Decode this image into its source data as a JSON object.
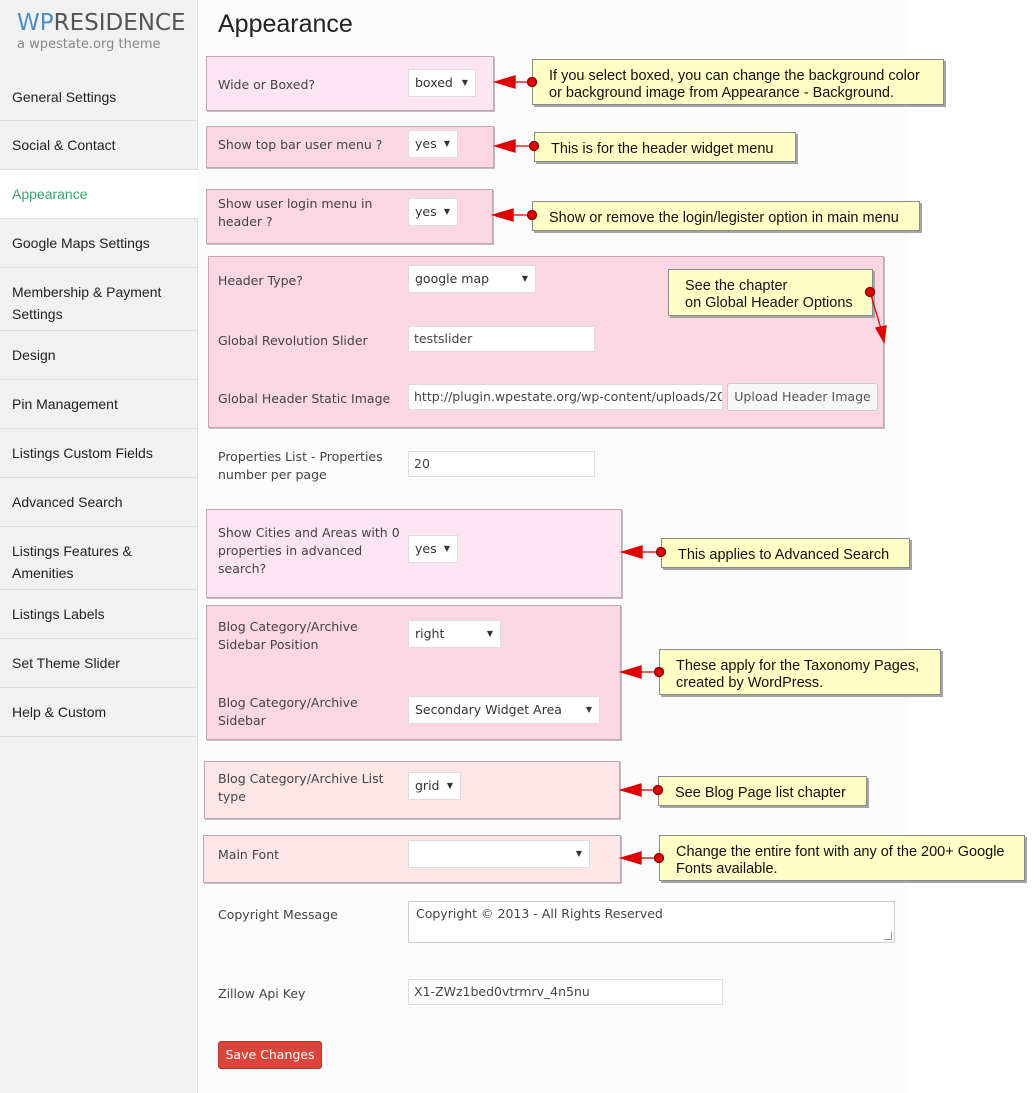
{
  "sidebar": {
    "logo_brand_wp": "WP",
    "logo_brand_rest": "RESIDENCE",
    "logo_tagline": "a wpestate.org theme",
    "items": [
      {
        "label": "General Settings"
      },
      {
        "label": "Social & Contact"
      },
      {
        "label": "Appearance",
        "active": true
      },
      {
        "label": "Google Maps Settings"
      },
      {
        "label_line1": "Membership & Payment",
        "label_line2": "Settings"
      },
      {
        "label": "Design"
      },
      {
        "label": "Pin Management"
      },
      {
        "label": "Listings Custom Fields"
      },
      {
        "label": "Advanced Search"
      },
      {
        "label_line1": "Listings Features &",
        "label_line2": "Amenities"
      },
      {
        "label": "Listings Labels"
      },
      {
        "label": "Set Theme Slider"
      },
      {
        "label": "Help & Custom"
      }
    ]
  },
  "main": {
    "title": "Appearance",
    "fields": {
      "wide_boxed": {
        "label": "Wide or Boxed?",
        "value": "boxed"
      },
      "top_bar_user_menu": {
        "label": "Show top bar user menu ?",
        "value": "yes"
      },
      "user_login_menu": {
        "label_line1": "Show user login menu in",
        "label_line2": "header ?",
        "value": "yes"
      },
      "header_type": {
        "label": "Header Type?",
        "value": "google map"
      },
      "global_revolution_slider": {
        "label": "Global Revolution Slider",
        "value": "testslider"
      },
      "global_header_static_image": {
        "label": "Global Header Static Image",
        "value": "http://plugin.wpestate.org/wp-content/uploads/20",
        "button": "Upload Header Image"
      },
      "properties_per_page": {
        "label_line1": "Properties List - Properties",
        "label_line2": "number per page",
        "value": "20"
      },
      "show_cities_areas": {
        "label_line1": "Show Cities and Areas with 0",
        "label_line2": "properties in advanced",
        "label_line3": "search?",
        "value": "yes"
      },
      "blog_sidebar_position": {
        "label_line1": "Blog Category/Archive",
        "label_line2": "Sidebar Position",
        "value": "right"
      },
      "blog_sidebar": {
        "label_line1": "Blog Category/Archive",
        "label_line2": "Sidebar",
        "value": "Secondary Widget Area"
      },
      "blog_list_type": {
        "label_line1": "Blog Category/Archive List",
        "label_line2": "type",
        "value": "grid"
      },
      "main_font": {
        "label": "Main Font",
        "value": ""
      },
      "copyright_message": {
        "label": "Copyright Message",
        "value": "Copyright © 2013 - All Rights Reserved"
      },
      "zillow_api_key": {
        "label": "Zillow Api Key",
        "value": "X1-ZWz1bed0vtrmrv_4n5nu"
      }
    },
    "save_label": "Save Changes"
  },
  "callouts": {
    "boxed": {
      "line1": "If you select boxed, you can change the background color",
      "line2": "or background image from Appearance - Background."
    },
    "top_bar": {
      "line1": "This is for the header widget menu"
    },
    "login": {
      "line1": "Show or remove the login/legister option in main menu"
    },
    "header": {
      "line1": "See the chapter",
      "line2": "on Global Header Options"
    },
    "advanced": {
      "line1": "This applies to Advanced Search"
    },
    "taxonomy": {
      "line1": "These apply for the Taxonomy Pages,",
      "line2": "created by WordPress."
    },
    "blog_list": {
      "line1": "See Blog Page list chapter"
    },
    "font": {
      "line1": "Change the entire font with any of the 200+ Google",
      "line2": "Fonts available."
    }
  },
  "icons": {
    "select_arrow": "▼"
  },
  "colors": {
    "active_nav": "#3aa56b",
    "save_button": "#d9453b",
    "callout_bg": "#ffffc6",
    "arrow_red": "#e00000"
  }
}
